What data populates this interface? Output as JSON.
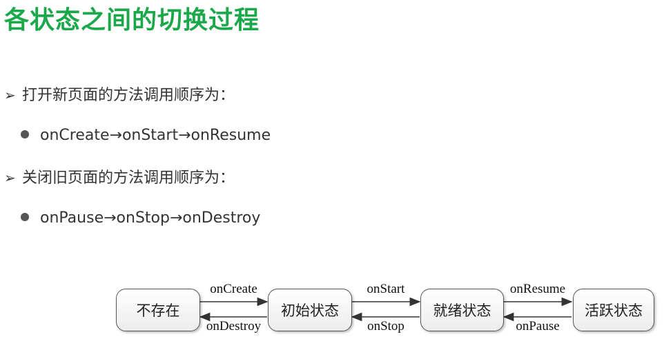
{
  "title": "各状态之间的切换过程",
  "open_section": {
    "marker": "➢",
    "heading": "打开新页面的方法调用顺序为：",
    "sequence": "onCreate→onStart→onResume"
  },
  "close_section": {
    "marker": "➢",
    "heading": "关闭旧页面的方法调用顺序为：",
    "sequence": "onPause→onStop→onDestroy"
  },
  "diagram": {
    "states": [
      "不存在",
      "初始状态",
      "就绪状态",
      "活跃状态"
    ],
    "forward_labels": [
      "onCreate",
      "onStart",
      "onResume"
    ],
    "backward_labels": [
      "onDestroy",
      "onStop",
      "onPause"
    ]
  },
  "colors": {
    "title": "#1aa84b",
    "text": "#333333",
    "box_border": "#555555"
  }
}
